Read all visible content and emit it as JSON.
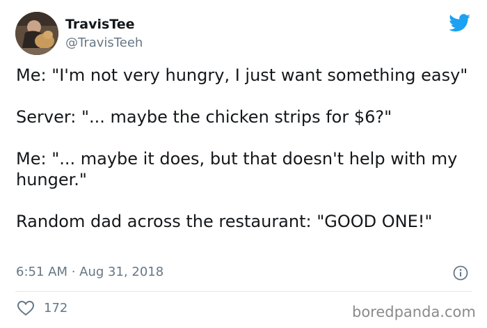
{
  "author": {
    "display_name": "TravisTee",
    "handle": "@TravisTeeh",
    "avatar_icon": "profile-photo"
  },
  "platform_icon": "twitter-bird-icon",
  "brand_color": "#1da1f2",
  "tweet": {
    "paragraphs": [
      "Me: \"I'm not very hungry, I just want something easy\"",
      "Server: \"... maybe the chicken strips for $6?\"",
      "Me: \"... maybe it does, but that doesn't help with my hunger.\"",
      "Random dad across the restaurant: \"GOOD ONE!\""
    ],
    "timestamp": "6:51 AM · Aug 31, 2018"
  },
  "actions": {
    "like_icon": "heart-outline-icon",
    "like_count": "172",
    "info_icon": "info-icon"
  },
  "watermark": "boredpanda.com"
}
